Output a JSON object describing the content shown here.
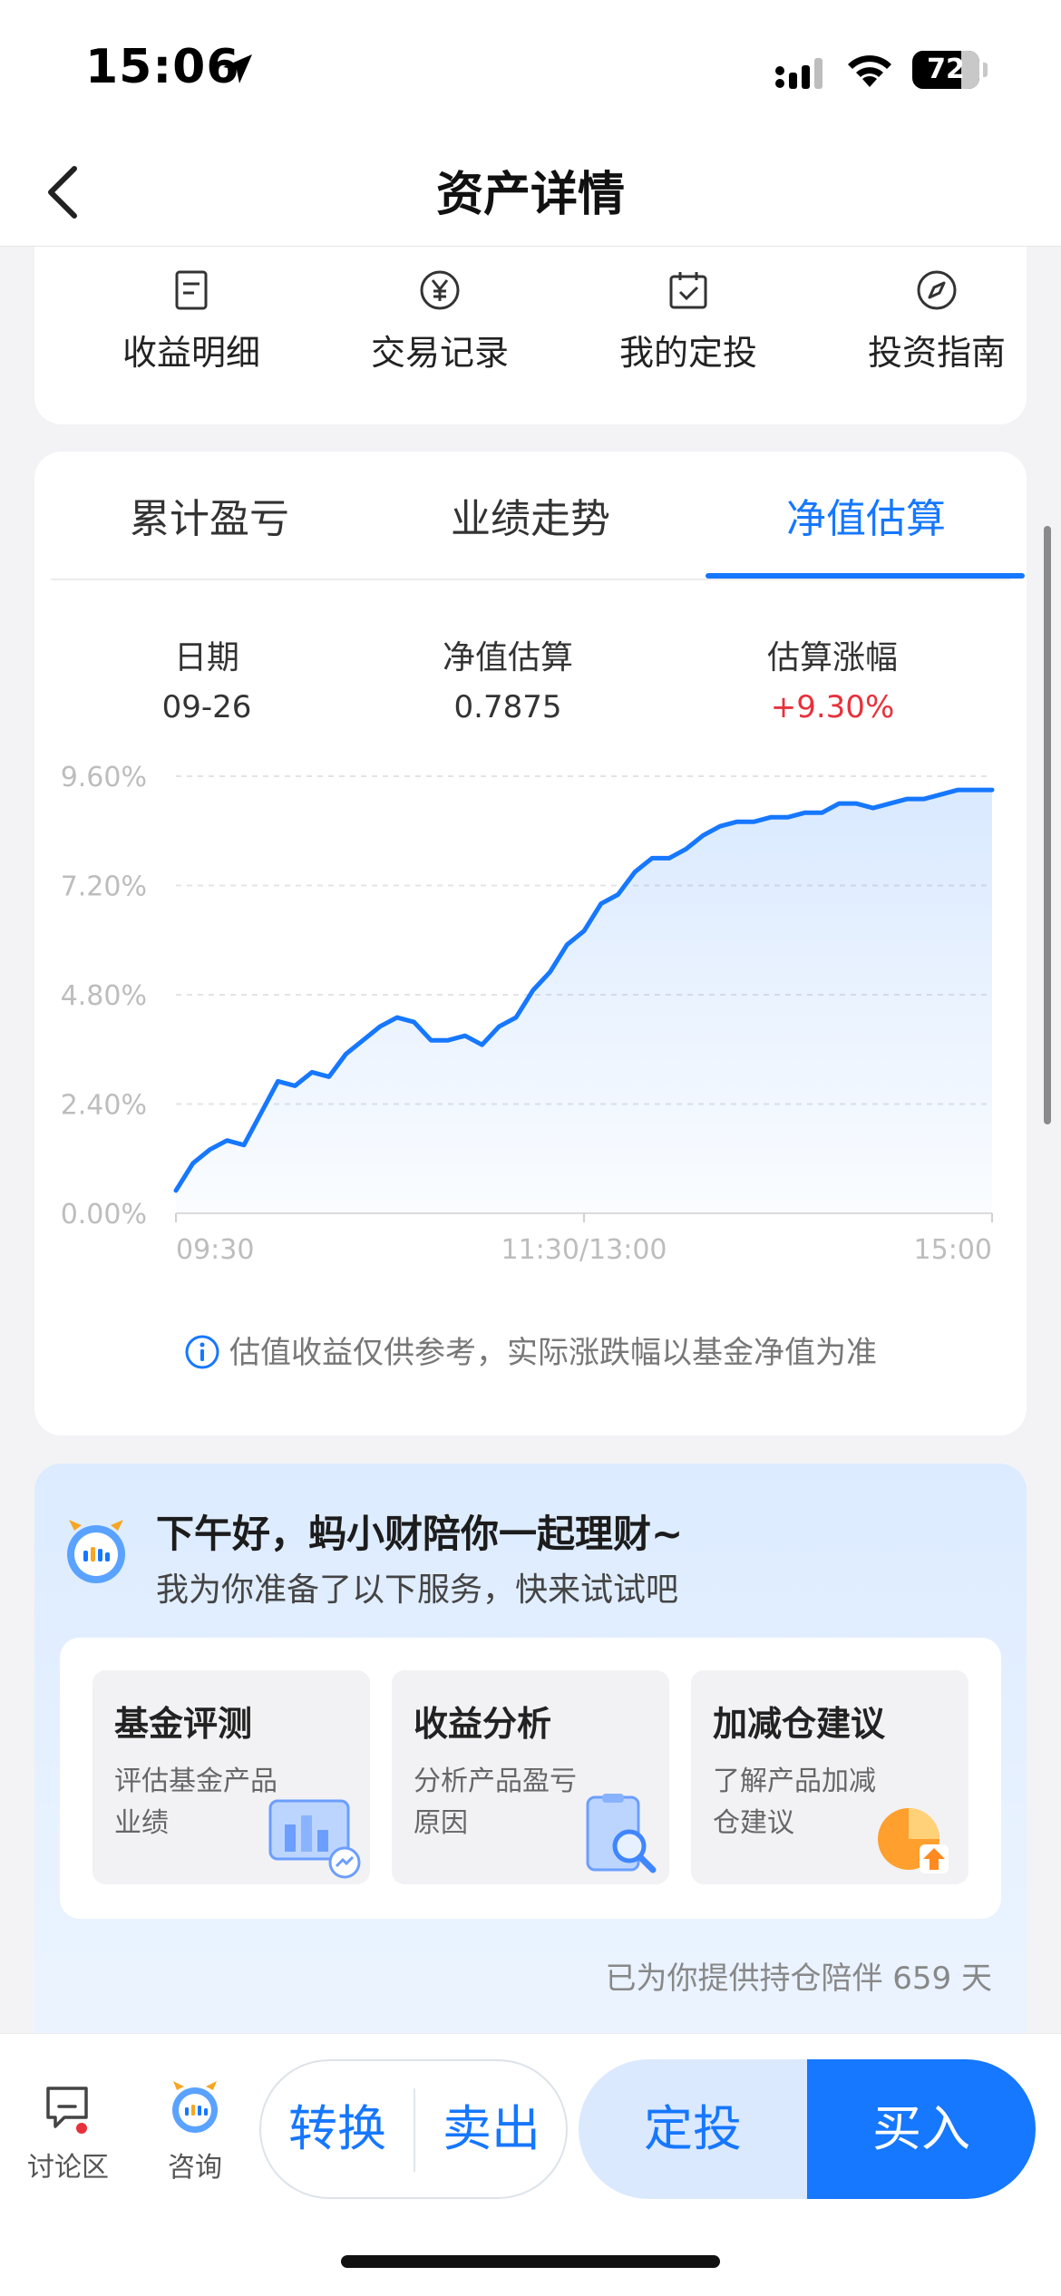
{
  "status_bar": {
    "time": "15:06",
    "battery": "72"
  },
  "nav": {
    "title": "资产详情"
  },
  "quick_links": [
    {
      "label": "收益明细",
      "icon": "document-icon"
    },
    {
      "label": "交易记录",
      "icon": "yen-circle-icon"
    },
    {
      "label": "我的定投",
      "icon": "calendar-check-icon"
    },
    {
      "label": "投资指南",
      "icon": "compass-icon"
    }
  ],
  "tabs": [
    "累计盈亏",
    "业绩走势",
    "净值估算"
  ],
  "active_tab": 2,
  "stats": {
    "date_label": "日期",
    "date_value": "09-26",
    "nav_label": "净值估算",
    "nav_value": "0.7875",
    "change_label": "估算涨幅",
    "change_value": "+9.30%"
  },
  "colors": {
    "accent": "#1677ff",
    "up": "#e8313c"
  },
  "chart_data": {
    "type": "line",
    "y_tick_labels": [
      "9.60%",
      "7.20%",
      "4.80%",
      "2.40%",
      "0.00%"
    ],
    "y_ticks": [
      9.6,
      7.2,
      4.8,
      2.4,
      0
    ],
    "ylim": [
      0,
      9.6
    ],
    "x_tick_labels": [
      "09:30",
      "11:30/13:00",
      "15:00"
    ],
    "x_range": [
      0,
      240
    ],
    "grid": true,
    "series": [
      {
        "x": [
          0,
          5,
          10,
          15,
          20,
          25,
          30,
          35,
          40,
          45,
          50,
          55,
          60,
          65,
          70,
          75,
          80,
          85,
          90,
          95,
          100,
          105,
          110,
          115,
          120,
          125,
          130,
          135,
          140,
          145,
          150,
          155,
          160,
          165,
          170,
          175,
          180,
          185,
          190,
          195,
          200,
          205,
          210,
          215,
          220,
          225,
          230,
          235,
          240
        ],
        "values": [
          0.5,
          1.1,
          1.4,
          1.6,
          1.5,
          2.2,
          2.9,
          2.8,
          3.1,
          3.0,
          3.5,
          3.8,
          4.1,
          4.3,
          4.2,
          3.8,
          3.8,
          3.9,
          3.7,
          4.1,
          4.3,
          4.9,
          5.3,
          5.9,
          6.2,
          6.8,
          7.0,
          7.5,
          7.8,
          7.8,
          8.0,
          8.3,
          8.5,
          8.6,
          8.6,
          8.7,
          8.7,
          8.8,
          8.8,
          9.0,
          9.0,
          8.9,
          9.0,
          9.1,
          9.1,
          9.2,
          9.3,
          9.3,
          9.3
        ]
      }
    ]
  },
  "note": "估值收益仅供参考，实际涨跌幅以基金净值为准",
  "assistant": {
    "greeting": "下午好，蚂小财陪你一起理财~",
    "sub": "我为你准备了以下服务，快来试试吧",
    "services": [
      {
        "title": "基金评测",
        "desc": "评估基金产品业绩"
      },
      {
        "title": "收益分析",
        "desc": "分析产品盈亏原因"
      },
      {
        "title": "加减仓建议",
        "desc": "了解产品加减仓建议"
      }
    ],
    "companion": "已为你提供持仓陪伴 659 天"
  },
  "bottom": {
    "discuss": "讨论区",
    "consult": "咨询",
    "convert": "转换",
    "sell": "卖出",
    "sip": "定投",
    "buy": "买入"
  }
}
